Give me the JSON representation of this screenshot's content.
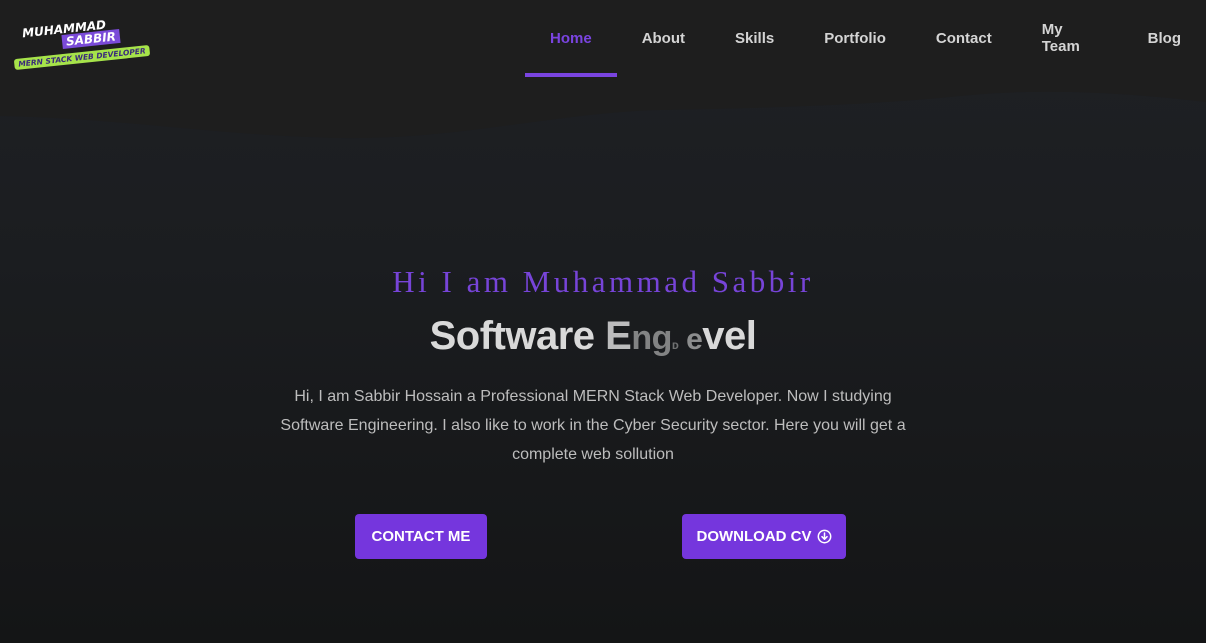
{
  "logo": {
    "line1": "MUHAMMAD",
    "line2": "SABBIR",
    "tagline": "MERN STACK WEB DEVELOPER"
  },
  "nav": {
    "items": [
      {
        "label": "Home",
        "active": true
      },
      {
        "label": "About",
        "active": false
      },
      {
        "label": "Skills",
        "active": false
      },
      {
        "label": "Portfolio",
        "active": false
      },
      {
        "label": "Contact",
        "active": false
      },
      {
        "label": "My Team",
        "active": false
      },
      {
        "label": "Blog",
        "active": false
      }
    ]
  },
  "hero": {
    "greeting": "Hi I am Muhammad Sabbir",
    "role_parts": [
      "Software ",
      "E",
      "ng",
      "ᴅ",
      " e",
      "vel"
    ],
    "description": "Hi, I am Sabbir Hossain a Professional MERN Stack Web Developer. Now I studying Software Engineering. I also like to work in the Cyber Security sector. Here you will get a complete web sollution",
    "contact_button": "CONTACT ME",
    "cv_button": "DOWNLOAD CV",
    "cv_icon": "download-circle-icon"
  },
  "colors": {
    "accent": "#7536dd",
    "background": "#1b1d20",
    "header": "#1e1e1e"
  }
}
